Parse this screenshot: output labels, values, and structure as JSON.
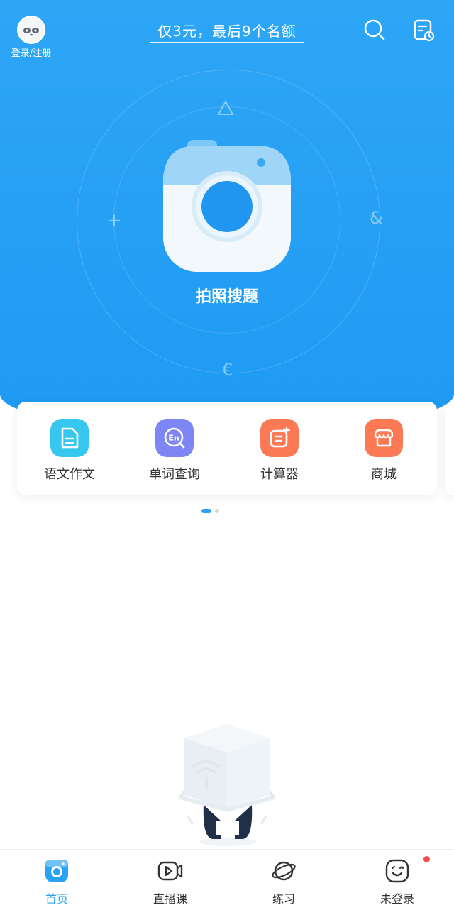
{
  "header": {
    "login_label": "登录/注册",
    "promo_text": "仅3元，最后9个名额"
  },
  "hero": {
    "camera_label": "拍照搜题",
    "deco_symbols": [
      "+",
      "&",
      "€"
    ]
  },
  "tools": [
    {
      "label": "语文作文",
      "icon": "essay-icon",
      "color": "#37c7ee"
    },
    {
      "label": "单词查询",
      "icon": "word-lookup-icon",
      "color": "#7d86f4"
    },
    {
      "label": "计算器",
      "icon": "calculator-icon",
      "color": "#fb7a55"
    },
    {
      "label": "商城",
      "icon": "shop-icon",
      "color": "#fb7a55"
    }
  ],
  "pager": {
    "pages": 2,
    "active": 1
  },
  "tabbar": {
    "items": [
      {
        "label": "首页",
        "icon": "home-camera-icon",
        "active": true
      },
      {
        "label": "直播课",
        "icon": "live-class-icon",
        "active": false
      },
      {
        "label": "练习",
        "icon": "practice-planet-icon",
        "active": false
      },
      {
        "label": "未登录",
        "icon": "profile-face-icon",
        "active": false,
        "badge": true
      }
    ]
  },
  "colors": {
    "accent": "#2aa3f4",
    "hero_blue": "#2ea6f6",
    "badge_red": "#f5504a"
  }
}
